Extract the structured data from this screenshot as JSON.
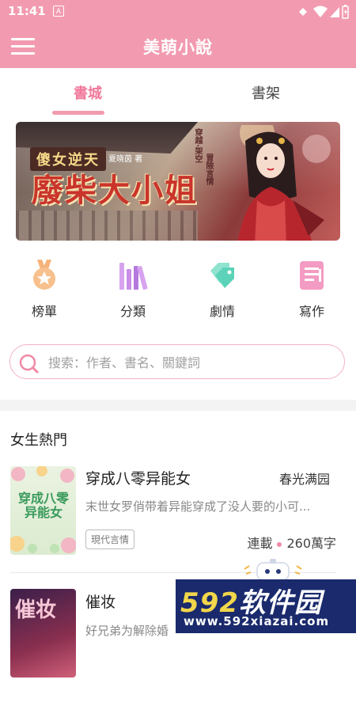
{
  "status_bar": {
    "time": "11:41",
    "notification_letter": "A"
  },
  "app_bar": {
    "title": "美萌小說",
    "menu_icon": "hamburger-icon"
  },
  "tabs": [
    {
      "label": "書城",
      "active": true
    },
    {
      "label": "書架",
      "active": false
    }
  ],
  "banner": {
    "small_title": "傻女逆天",
    "author": "夏晓茵 著",
    "main_title": "廢柴大小姐",
    "side_text_1": "穿越·架空",
    "side_text_2": "冒險言情"
  },
  "quick_nav": [
    {
      "label": "榜單",
      "icon": "medal-icon",
      "color": "#f5b37a"
    },
    {
      "label": "分類",
      "icon": "books-icon",
      "color": "#c98ee6"
    },
    {
      "label": "劇情",
      "icon": "tags-icon",
      "color": "#5cd3b8"
    },
    {
      "label": "寫作",
      "icon": "notebook-icon",
      "color": "#f39bc2"
    }
  ],
  "search": {
    "placeholder": "搜索：作者、書名、關鍵詞"
  },
  "section": {
    "title": "女生熱門"
  },
  "books": [
    {
      "title": "穿成八零异能女",
      "author": "春光满园",
      "description": "末世女罗俏带着异能穿成了没人要的小可...",
      "tag": "現代言情",
      "status": "連載",
      "word_count": "260萬字",
      "cover_text": "穿成八零异能女"
    },
    {
      "title": "催妆",
      "author": "",
      "description": "好兄弟为解除婚",
      "tag": "",
      "status": "",
      "word_count": "",
      "cover_text": "催妆"
    }
  ],
  "watermark": {
    "brand_num": "592",
    "brand_text": "软件园",
    "url": "www.592xiazai.com"
  },
  "colors": {
    "primary": "#f29bb0",
    "accent": "#f0789a"
  }
}
